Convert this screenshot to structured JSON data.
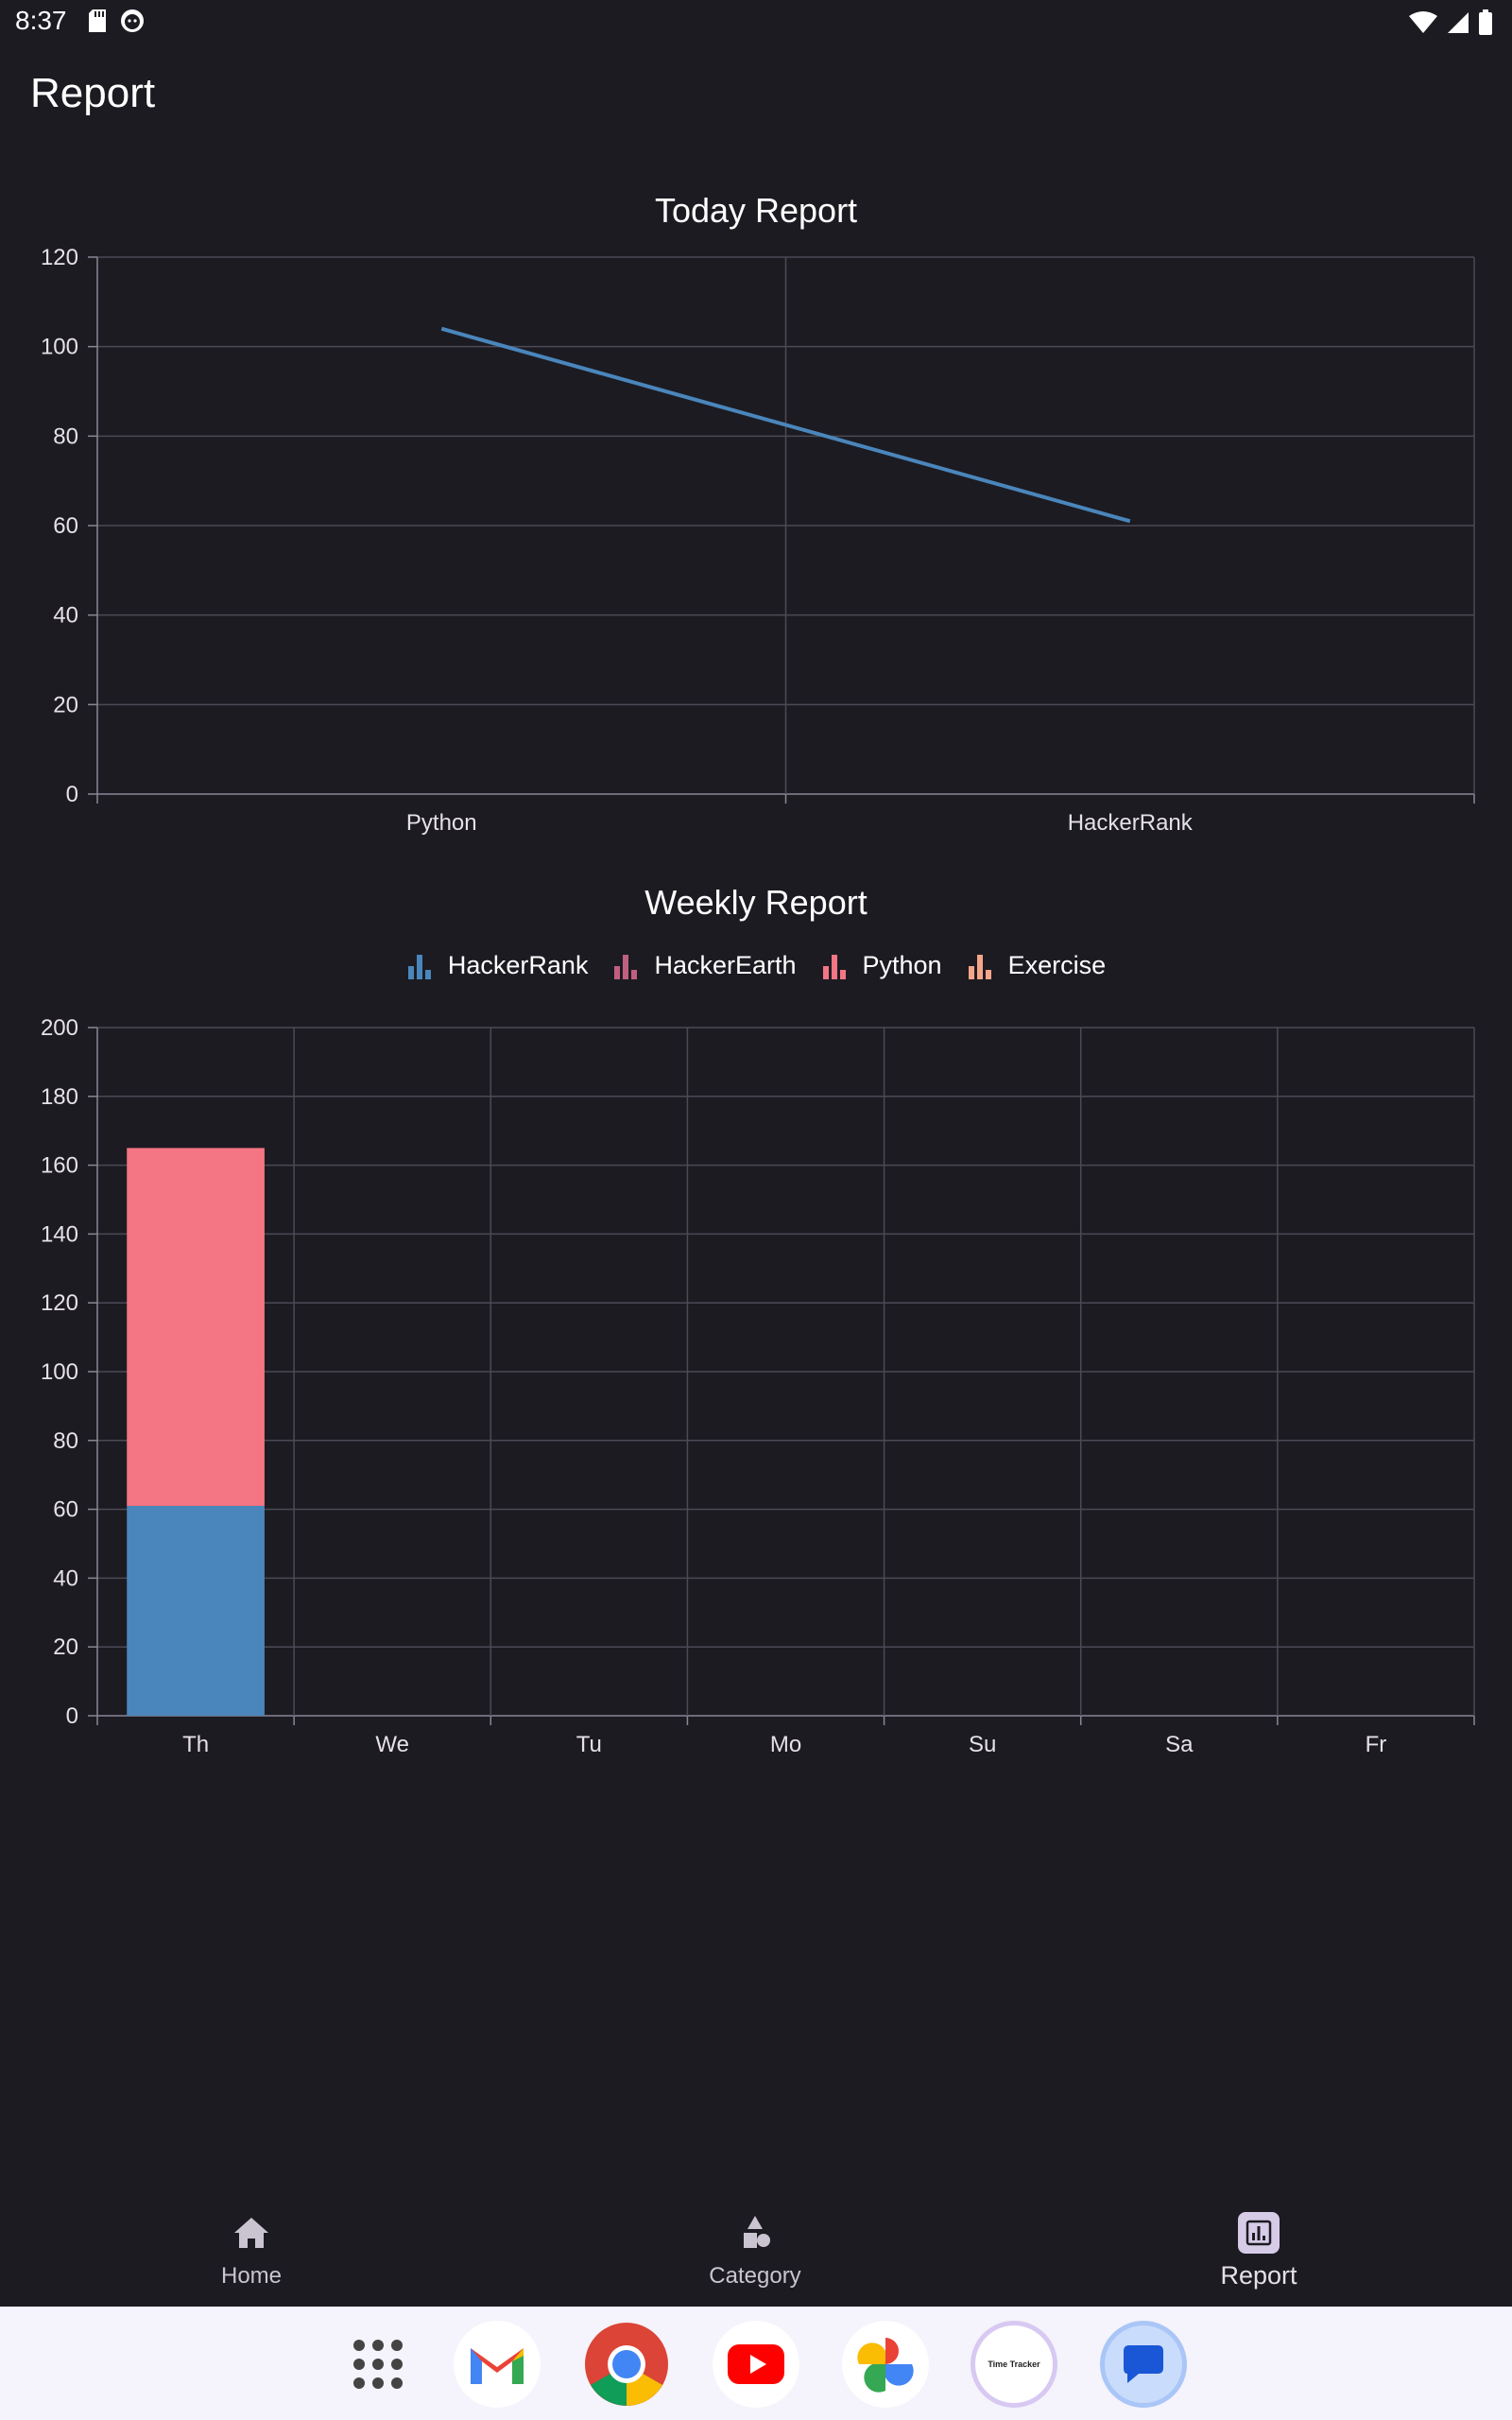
{
  "status_bar": {
    "time": "8:37",
    "left_icons": [
      "sd-card-icon",
      "notification-face-icon"
    ],
    "right_icons": [
      "wifi-icon",
      "cell-signal-icon",
      "battery-icon"
    ]
  },
  "app_bar": {
    "title": "Report"
  },
  "charts": {
    "today": {
      "title": "Today Report"
    },
    "weekly": {
      "title": "Weekly Report",
      "legend": [
        {
          "label": "HackerRank",
          "color": "#4a86bb"
        },
        {
          "label": "HackerEarth",
          "color": "#c0607e"
        },
        {
          "label": "Python",
          "color": "#f47583"
        },
        {
          "label": "Exercise",
          "color": "#f5a68a"
        }
      ]
    }
  },
  "chart_data": [
    {
      "type": "line",
      "title": "Today Report",
      "categories": [
        "Python",
        "HackerRank"
      ],
      "series": [
        {
          "values": [
            104,
            61
          ],
          "color": "#4a86bb"
        }
      ],
      "ylim": [
        0,
        120
      ],
      "yticks": [
        0,
        20,
        40,
        60,
        80,
        100,
        120
      ],
      "grid": true
    },
    {
      "type": "bar",
      "stacked": true,
      "title": "Weekly Report",
      "categories": [
        "Th",
        "We",
        "Tu",
        "Mo",
        "Su",
        "Sa",
        "Fr"
      ],
      "series": [
        {
          "name": "HackerRank",
          "color": "#4a86bb",
          "values": [
            61,
            0,
            0,
            0,
            0,
            0,
            0
          ]
        },
        {
          "name": "HackerEarth",
          "color": "#c0607e",
          "values": [
            0,
            0,
            0,
            0,
            0,
            0,
            0
          ]
        },
        {
          "name": "Python",
          "color": "#f47583",
          "values": [
            104,
            0,
            0,
            0,
            0,
            0,
            0
          ]
        },
        {
          "name": "Exercise",
          "color": "#f5a68a",
          "values": [
            0,
            0,
            0,
            0,
            0,
            0,
            0
          ]
        }
      ],
      "ylim": [
        0,
        200
      ],
      "yticks": [
        0,
        20,
        40,
        60,
        80,
        100,
        120,
        140,
        160,
        180,
        200
      ],
      "legend_position": "top",
      "grid": true
    }
  ],
  "bottom_nav": {
    "items": [
      {
        "label": "Home",
        "icon": "home-icon",
        "active": false
      },
      {
        "label": "Category",
        "icon": "category-icon",
        "active": false
      },
      {
        "label": "Report",
        "icon": "report-icon",
        "active": true
      }
    ]
  },
  "dock": {
    "apps": [
      "app-drawer-icon",
      "gmail-icon",
      "chrome-icon",
      "youtube-icon",
      "photos-icon",
      "time-tracker-icon",
      "messages-icon"
    ],
    "time_tracker_label": "Time Tracker"
  }
}
